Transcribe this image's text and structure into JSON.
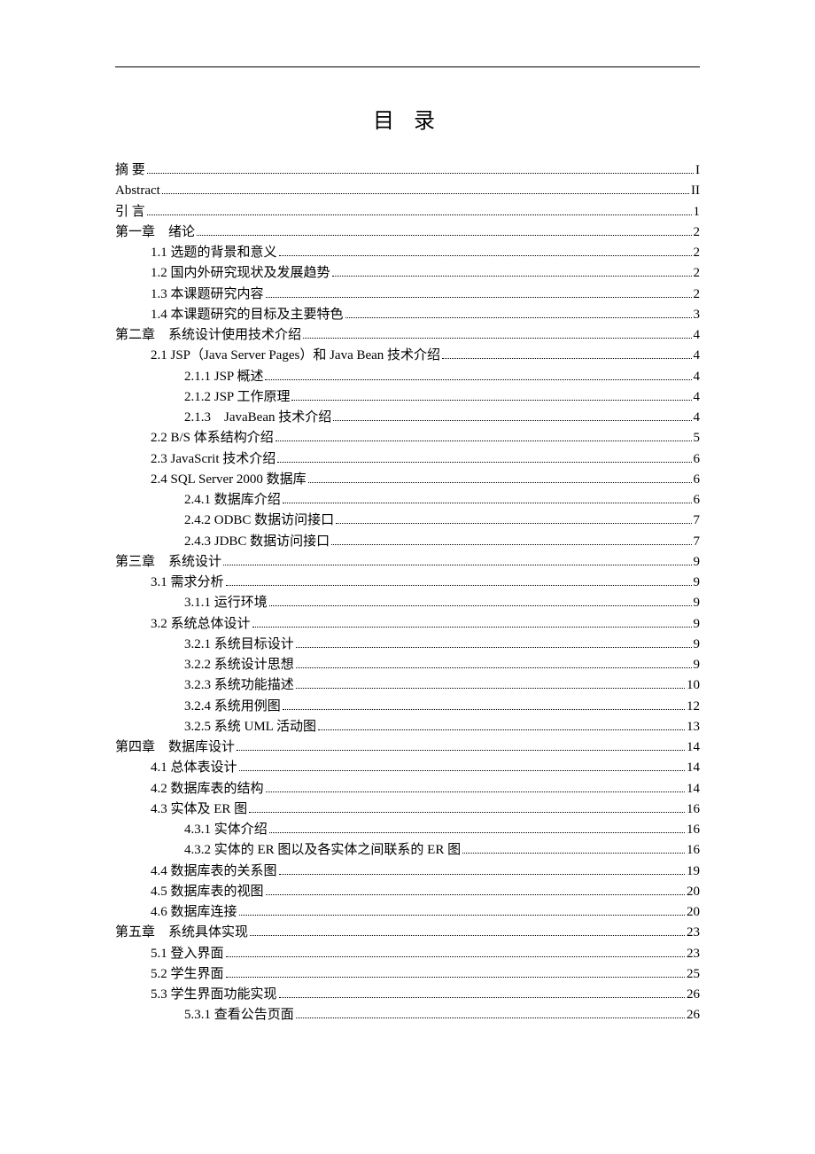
{
  "title": "目 录",
  "toc": [
    {
      "level": 0,
      "label": "摘 要",
      "page": "I"
    },
    {
      "level": 0,
      "label": "Abstract",
      "page": "II"
    },
    {
      "level": 0,
      "label": "引 言",
      "page": "1"
    },
    {
      "level": 0,
      "label": "第一章　绪论",
      "page": "2"
    },
    {
      "level": 1,
      "label": "1.1 选题的背景和意义",
      "page": "2"
    },
    {
      "level": 1,
      "label": "1.2 国内外研究现状及发展趋势",
      "page": "2"
    },
    {
      "level": 1,
      "label": "1.3 本课题研究内容",
      "page": "2"
    },
    {
      "level": 1,
      "label": "1.4 本课题研究的目标及主要特色",
      "page": "3"
    },
    {
      "level": 0,
      "label": "第二章　系统设计使用技术介绍",
      "page": "4"
    },
    {
      "level": 1,
      "label": "2.1 JSP（Java Server Pages）和 Java Bean 技术介绍",
      "page": "4"
    },
    {
      "level": 2,
      "label": "2.1.1 JSP 概述",
      "page": "4"
    },
    {
      "level": 2,
      "label": "2.1.2 JSP 工作原理",
      "page": "4"
    },
    {
      "level": 2,
      "label": "2.1.3　JavaBean 技术介绍",
      "page": "4"
    },
    {
      "level": 1,
      "label": "2.2 B/S 体系结构介绍",
      "page": "5"
    },
    {
      "level": 1,
      "label": "2.3 JavaScrit 技术介绍",
      "page": "6"
    },
    {
      "level": 1,
      "label": "2.4 SQL Server 2000 数据库",
      "page": "6"
    },
    {
      "level": 2,
      "label": "2.4.1 数据库介绍",
      "page": "6"
    },
    {
      "level": 2,
      "label": "2.4.2 ODBC 数据访问接口",
      "page": "7"
    },
    {
      "level": 2,
      "label": "2.4.3 JDBC 数据访问接口",
      "page": "7"
    },
    {
      "level": 0,
      "label": "第三章　系统设计",
      "page": "9"
    },
    {
      "level": 1,
      "label": "3.1 需求分析",
      "page": "9"
    },
    {
      "level": 2,
      "label": "3.1.1 运行环境",
      "page": "9"
    },
    {
      "level": 1,
      "label": "3.2 系统总体设计",
      "page": "9"
    },
    {
      "level": 2,
      "label": "3.2.1 系统目标设计",
      "page": "9"
    },
    {
      "level": 2,
      "label": "3.2.2 系统设计思想",
      "page": "9"
    },
    {
      "level": 2,
      "label": "3.2.3 系统功能描述",
      "page": "10"
    },
    {
      "level": 2,
      "label": "3.2.4 系统用例图",
      "page": "12"
    },
    {
      "level": 2,
      "label": "3.2.5 系统 UML 活动图",
      "page": "13"
    },
    {
      "level": 0,
      "label": "第四章　数据库设计",
      "page": "14"
    },
    {
      "level": 1,
      "label": "4.1 总体表设计",
      "page": "14"
    },
    {
      "level": 1,
      "label": "4.2 数据库表的结构",
      "page": "14"
    },
    {
      "level": 1,
      "label": "4.3 实体及 ER 图",
      "page": "16"
    },
    {
      "level": 2,
      "label": "4.3.1 实体介绍",
      "page": "16"
    },
    {
      "level": 2,
      "label": "4.3.2 实体的 ER 图以及各实体之间联系的 ER 图",
      "page": "16"
    },
    {
      "level": 1,
      "label": "4.4 数据库表的关系图",
      "page": "19"
    },
    {
      "level": 1,
      "label": "4.5 数据库表的视图",
      "page": "20"
    },
    {
      "level": 1,
      "label": "4.6 数据库连接",
      "page": "20"
    },
    {
      "level": 0,
      "label": "第五章　系统具体实现",
      "page": "23"
    },
    {
      "level": 1,
      "label": "5.1 登入界面",
      "page": "23"
    },
    {
      "level": 1,
      "label": "5.2 学生界面",
      "page": "25"
    },
    {
      "level": 1,
      "label": "5.3 学生界面功能实现",
      "page": "26"
    },
    {
      "level": 2,
      "label": "5.3.1 查看公告页面",
      "page": "26"
    }
  ]
}
